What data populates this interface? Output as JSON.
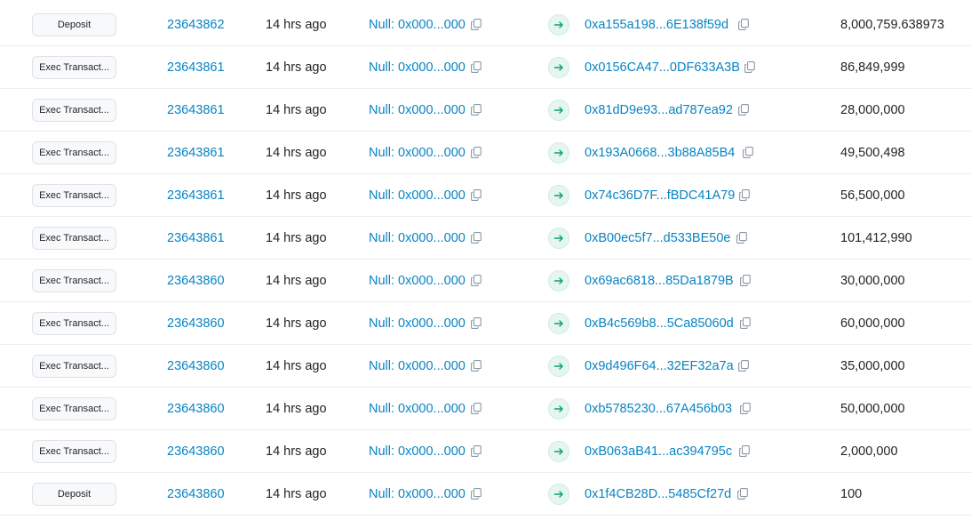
{
  "colors": {
    "link": "#0784c3",
    "text": "#212529",
    "arrow_bg": "#e6f6ef",
    "arrow": "#00a186"
  },
  "icons": {
    "copy": "copy-icon",
    "direction": "arrow-right-icon"
  },
  "rows": [
    {
      "method": "Deposit",
      "block": "23643862",
      "age": "14 hrs ago",
      "from": "Null: 0x000...000",
      "to": "0xa155a198...6E138f59d",
      "amount": "8,000,759.638973"
    },
    {
      "method": "Exec Transact...",
      "block": "23643861",
      "age": "14 hrs ago",
      "from": "Null: 0x000...000",
      "to": "0x0156CA47...0DF633A3B",
      "amount": "86,849,999"
    },
    {
      "method": "Exec Transact...",
      "block": "23643861",
      "age": "14 hrs ago",
      "from": "Null: 0x000...000",
      "to": "0x81dD9e93...ad787ea92",
      "amount": "28,000,000"
    },
    {
      "method": "Exec Transact...",
      "block": "23643861",
      "age": "14 hrs ago",
      "from": "Null: 0x000...000",
      "to": "0x193A0668...3b88A85B4",
      "amount": "49,500,498"
    },
    {
      "method": "Exec Transact...",
      "block": "23643861",
      "age": "14 hrs ago",
      "from": "Null: 0x000...000",
      "to": "0x74c36D7F...fBDC41A79",
      "amount": "56,500,000"
    },
    {
      "method": "Exec Transact...",
      "block": "23643861",
      "age": "14 hrs ago",
      "from": "Null: 0x000...000",
      "to": "0xB00ec5f7...d533BE50e",
      "amount": "101,412,990"
    },
    {
      "method": "Exec Transact...",
      "block": "23643860",
      "age": "14 hrs ago",
      "from": "Null: 0x000...000",
      "to": "0x69ac6818...85Da1879B",
      "amount": "30,000,000"
    },
    {
      "method": "Exec Transact...",
      "block": "23643860",
      "age": "14 hrs ago",
      "from": "Null: 0x000...000",
      "to": "0xB4c569b8...5Ca85060d",
      "amount": "60,000,000"
    },
    {
      "method": "Exec Transact...",
      "block": "23643860",
      "age": "14 hrs ago",
      "from": "Null: 0x000...000",
      "to": "0x9d496F64...32EF32a7a",
      "amount": "35,000,000"
    },
    {
      "method": "Exec Transact...",
      "block": "23643860",
      "age": "14 hrs ago",
      "from": "Null: 0x000...000",
      "to": "0xb5785230...67A456b03",
      "amount": "50,000,000"
    },
    {
      "method": "Exec Transact...",
      "block": "23643860",
      "age": "14 hrs ago",
      "from": "Null: 0x000...000",
      "to": "0xB063aB41...ac394795c",
      "amount": "2,000,000"
    },
    {
      "method": "Deposit",
      "block": "23643860",
      "age": "14 hrs ago",
      "from": "Null: 0x000...000",
      "to": "0x1f4CB28D...5485Cf27d",
      "amount": "100"
    }
  ]
}
